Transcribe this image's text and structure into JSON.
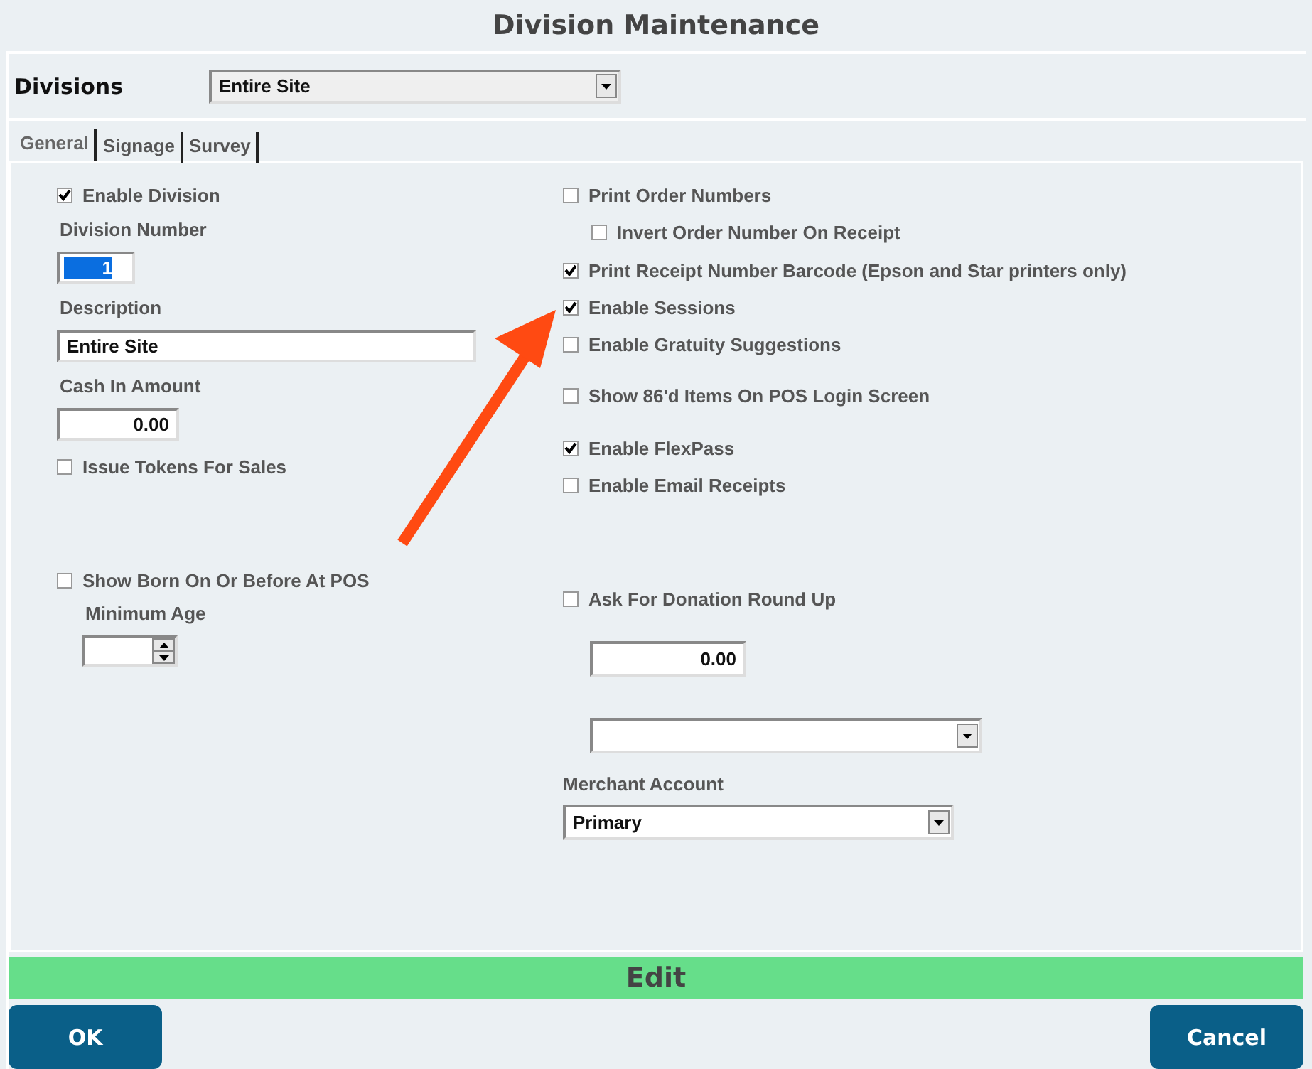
{
  "title": "Division Maintenance",
  "divisions": {
    "label": "Divisions",
    "value": "Entire Site"
  },
  "tabs": [
    {
      "label": "General",
      "selected": true
    },
    {
      "label": "Signage",
      "selected": false
    },
    {
      "label": "Survey",
      "selected": false
    }
  ],
  "left": {
    "enable_division": {
      "label": "Enable Division",
      "checked": true
    },
    "division_number": {
      "label": "Division Number",
      "value": "1"
    },
    "description": {
      "label": "Description",
      "value": "Entire Site"
    },
    "cash_in_amount": {
      "label": "Cash In Amount",
      "value": "0.00"
    },
    "issue_tokens": {
      "label": "Issue Tokens For Sales",
      "checked": false
    },
    "show_born": {
      "label": "Show Born On Or Before At POS",
      "checked": false
    },
    "minimum_age": {
      "label": "Minimum Age"
    }
  },
  "options": [
    {
      "label": "Print Order Numbers",
      "checked": false,
      "children": [
        {
          "label": "Invert Order Number On Receipt",
          "checked": false
        }
      ]
    },
    {
      "label": "Print Receipt Number Barcode (Epson and Star printers only)",
      "checked": true
    },
    {
      "label": "Enable Sessions",
      "checked": true
    },
    {
      "label": "Enable Gratuity Suggestions",
      "checked": false
    },
    {
      "label": "Show 86'd Items On POS Login Screen",
      "checked": false
    },
    {
      "label": "Enable FlexPass",
      "checked": true
    },
    {
      "label": "Enable Email Receipts",
      "checked": false
    }
  ],
  "donation": {
    "label": "Ask For Donation Round Up",
    "checked": false,
    "amount": "0.00"
  },
  "merchant_account": {
    "label": "Merchant Account",
    "value": "Primary"
  },
  "status": "Edit",
  "buttons": [
    {
      "label": "OK"
    },
    {
      "label": "Cancel"
    }
  ]
}
